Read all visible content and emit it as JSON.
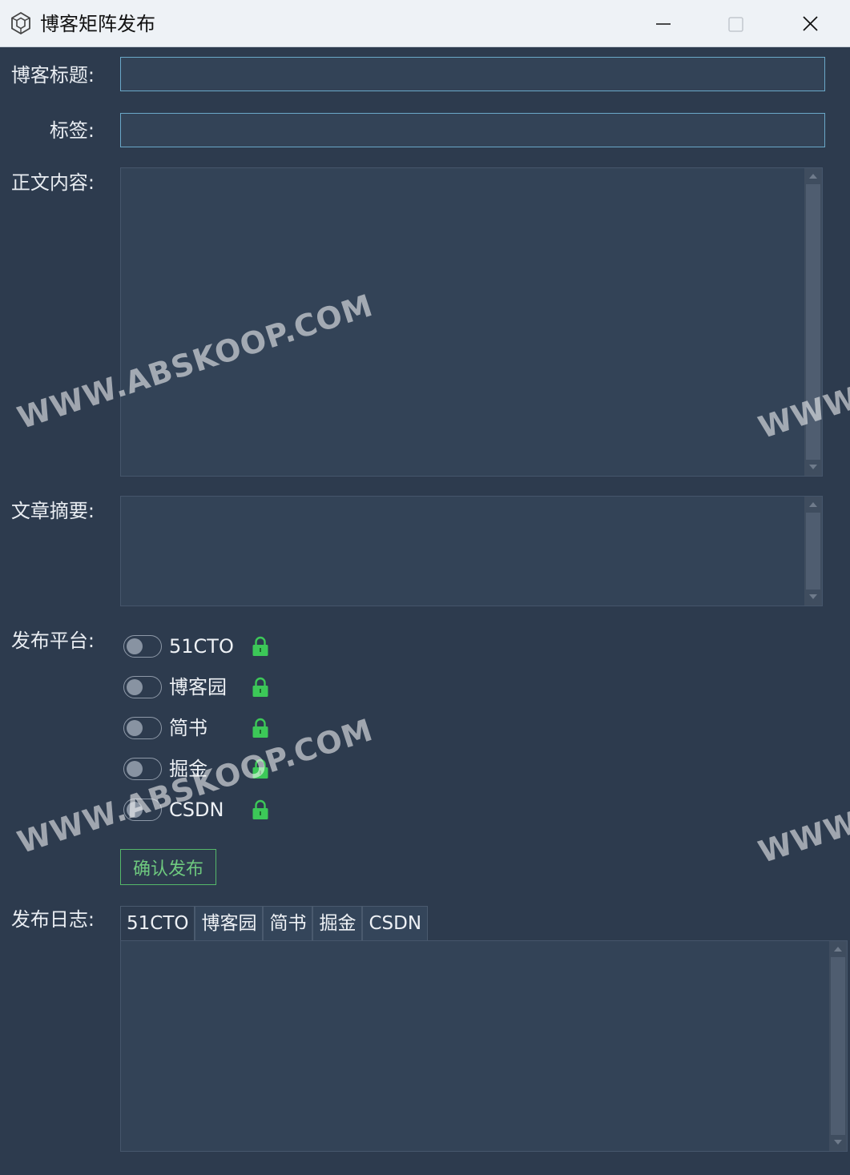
{
  "window": {
    "title": "博客矩阵发布",
    "controls": {
      "minimize": "minimize",
      "maximize": "maximize",
      "close": "close"
    }
  },
  "form": {
    "title_label": "博客标题:",
    "title_value": "",
    "tags_label": "标签:",
    "tags_value": "",
    "content_label": "正文内容:",
    "content_value": "",
    "summary_label": "文章摘要:",
    "summary_value": "",
    "platform_label": "发布平台:",
    "platforms": [
      {
        "name": "51CTO",
        "enabled": false,
        "lock": "lock-icon"
      },
      {
        "name": "博客园",
        "enabled": false,
        "lock": "lock-icon"
      },
      {
        "name": "简书",
        "enabled": false,
        "lock": "lock-icon"
      },
      {
        "name": "掘金",
        "enabled": false,
        "lock": "lock-icon"
      },
      {
        "name": "CSDN",
        "enabled": false,
        "lock": "lock-icon"
      }
    ],
    "confirm_label": "确认发布",
    "log_label": "发布日志:",
    "log_tabs": [
      "51CTO",
      "博客园",
      "简书",
      "掘金",
      "CSDN"
    ],
    "active_log_tab": "51CTO",
    "log_value": ""
  },
  "colors": {
    "background": "#2d3b4e",
    "field": "#334357",
    "accent_green": "#3cc858",
    "input_border": "#6aa8c8"
  },
  "watermarks": {
    "text": "WWW.ABSKOOP.COM",
    "partial": "WWW"
  }
}
